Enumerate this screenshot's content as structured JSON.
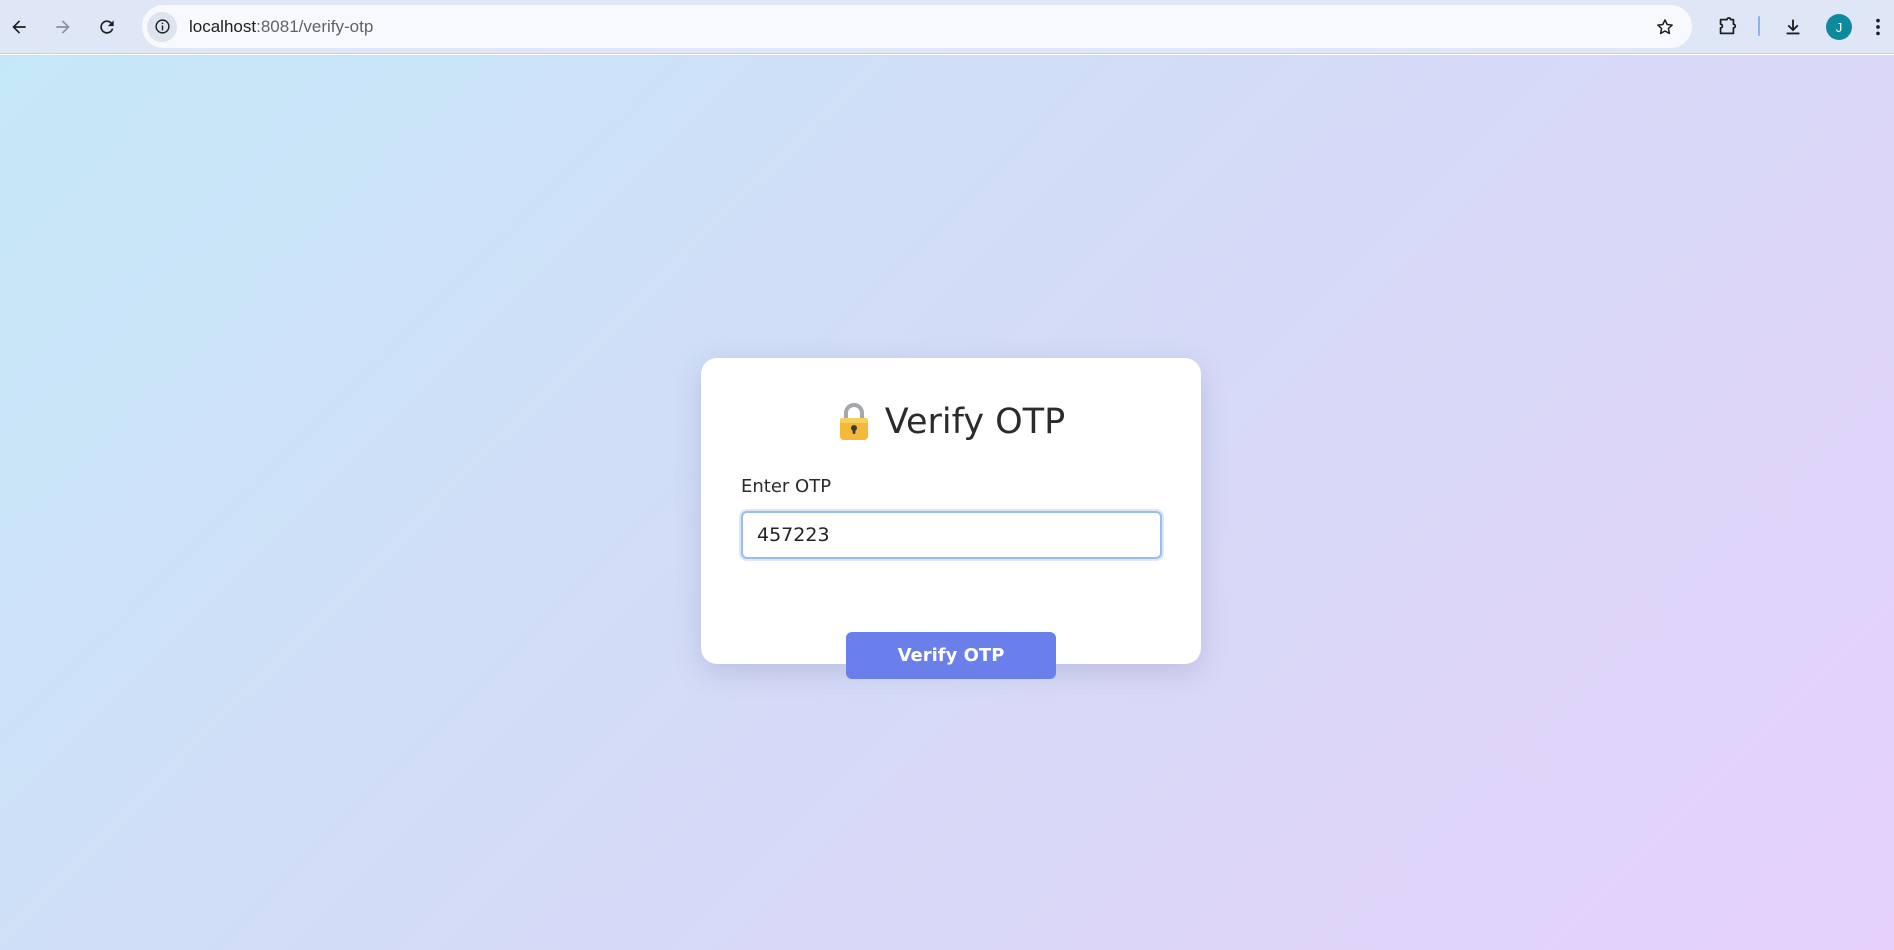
{
  "browser": {
    "url_host": "localhost",
    "url_path": ":8081/verify-otp",
    "profile_initial": "J",
    "icons": {
      "back": "arrow-left-icon",
      "forward": "arrow-right-icon",
      "reload": "reload-icon",
      "site_info": "info-icon",
      "bookmark": "star-icon",
      "extensions": "puzzle-icon",
      "downloads": "download-icon",
      "menu": "kebab-menu-icon"
    }
  },
  "page": {
    "title": "Verify OTP",
    "title_icon": "lock-icon",
    "otp_label": "Enter OTP",
    "otp_value": "457223",
    "submit_label": "Verify OTP"
  },
  "colors": {
    "button": "#6a7fea",
    "avatar": "#0e8a9e",
    "input_focus": "#9bbcf0"
  }
}
